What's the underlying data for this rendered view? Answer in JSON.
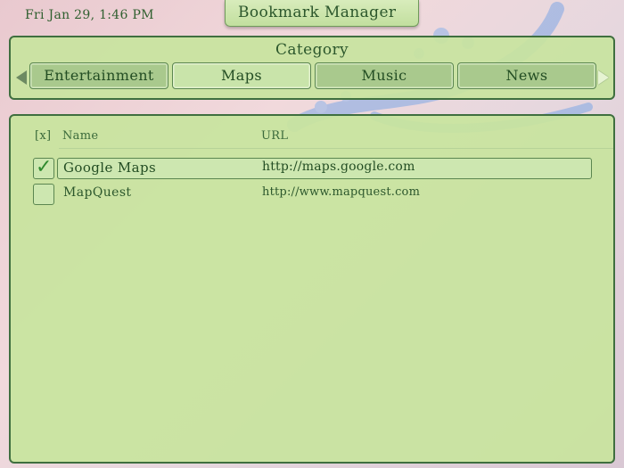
{
  "header": {
    "datetime": "Fri Jan 29, 1:46 PM",
    "app_title": "Bookmark Manager"
  },
  "category": {
    "title": "Category",
    "prev_icon": "left-arrow-icon",
    "next_icon": "right-arrow-icon",
    "tabs": [
      {
        "label": "Entertainment"
      },
      {
        "label": "Maps",
        "selected": true
      },
      {
        "label": "Music"
      },
      {
        "label": "News"
      }
    ]
  },
  "bookmarks": {
    "columns": {
      "select": "[x]",
      "name": "Name",
      "url": "URL"
    },
    "rows": [
      {
        "name": "Google Maps",
        "url": "http://maps.google.com",
        "checked": true,
        "check_glyph": "✓"
      },
      {
        "name": "MapQuest",
        "url": "http://www.mapquest.com",
        "checked": false
      }
    ]
  },
  "colors": {
    "panel_bg": "#c8e49e",
    "panel_border": "#3f6f3f",
    "text": "#234d23",
    "check": "#2f8a2f"
  }
}
